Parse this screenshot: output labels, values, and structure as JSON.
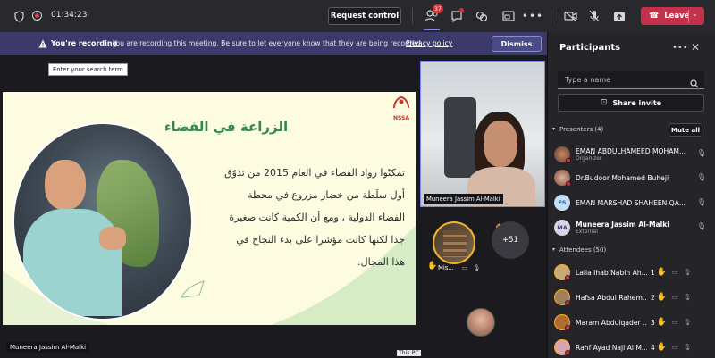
{
  "topbar": {
    "timer": "01:34:23",
    "request_control": "Request control",
    "participants_badge": "37",
    "leave": "Leave"
  },
  "banner": {
    "title": "You're recording",
    "message": "You are recording this meeting. Be sure to let everyone know that they are being recorded.",
    "link": "Privacy policy",
    "dismiss": "Dismiss"
  },
  "tooltip": "Enter your search term",
  "slide": {
    "logo_text": "NSSA",
    "title": "الزراعة في الفضاء",
    "lines": [
      "تمكنّوا رواد الفضاء في العام 2015 من تذوّق",
      "أول سلَطة من خضار مزروع في محطة",
      "الفضاء الدولية ، ومع أن الكمية كانت صغيرة",
      "جدا لكنها كانت مؤشرا على بدء النجاح في",
      "هذا المجال."
    ],
    "presenter": "Muneera Jassim Al-Malki"
  },
  "video": {
    "name": "Muneera Jassim Al-Malki",
    "thumb_label": "Mis...",
    "more_count": "+51",
    "this_pc": "This PC"
  },
  "panel": {
    "title": "Participants",
    "search_placeholder": "Type a name",
    "share_invite": "Share invite",
    "presenters_header": "Presenters (4)",
    "mute_all": "Mute all",
    "presenters": [
      {
        "initials": "",
        "name": "EMAN ABDULHAMEED MOHAM...",
        "sub": "Organizer",
        "color": "#8a5a3c"
      },
      {
        "initials": "",
        "name": "Dr.Budoor Mohamed Buheji",
        "sub": "",
        "color": "#6b4a3a"
      },
      {
        "initials": "ES",
        "name": "EMAN MARSHAD SHAHEEN QA...",
        "sub": "",
        "color": "#c7dff5"
      },
      {
        "initials": "MA",
        "name": "Muneera Jassim Al-Malki",
        "sub": "External",
        "color": "#d9d4e8"
      }
    ],
    "attendees_header": "Attendees (50)",
    "attendees": [
      {
        "name": "Laila Ihab Nabih Ah...",
        "num": "1",
        "color": "#c9a97a"
      },
      {
        "name": "Hafsa Abdul Rahem...",
        "num": "2",
        "color": "#a07f5c"
      },
      {
        "name": "Maram Abdulqader ...",
        "num": "3",
        "color": "#b46a2e"
      },
      {
        "name": "Rahf Ayad Naji Al M...",
        "num": "4",
        "color": "#d7a4b0"
      }
    ]
  }
}
